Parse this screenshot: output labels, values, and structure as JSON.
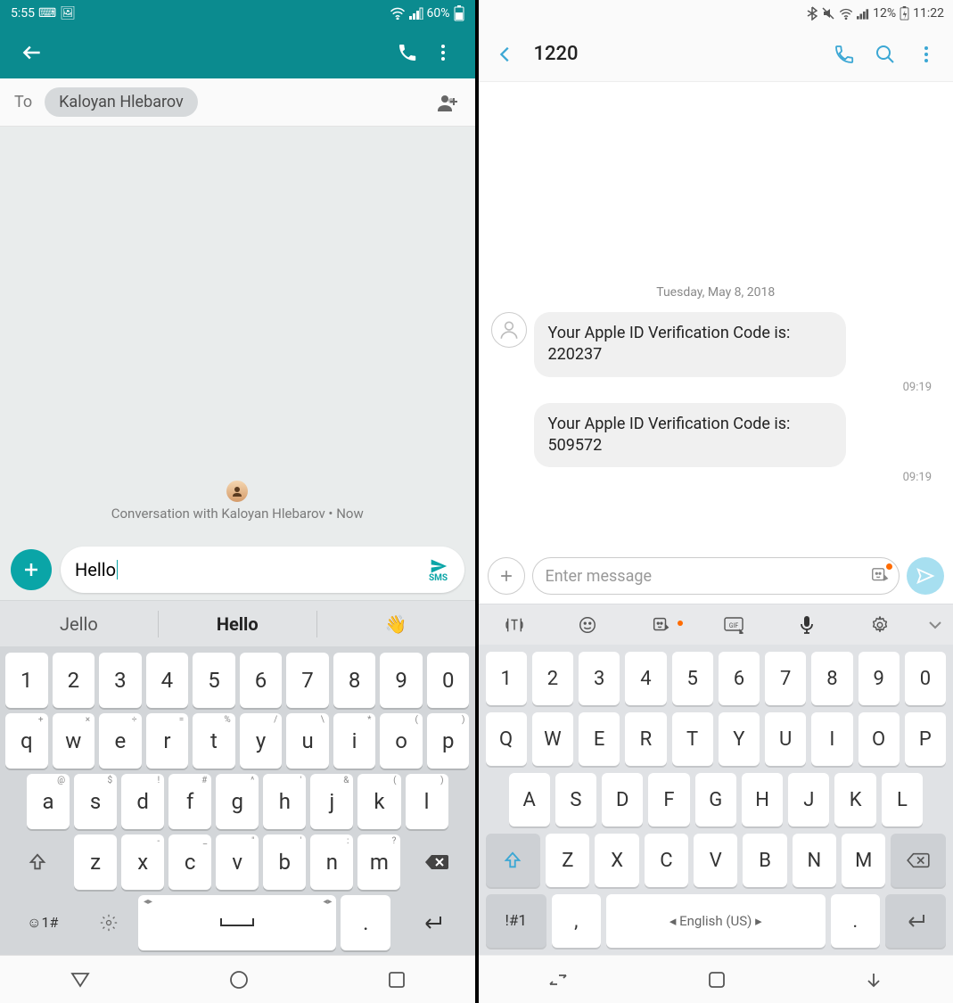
{
  "left": {
    "status": {
      "time": "5:55",
      "battery": "60%"
    },
    "toLabel": "To",
    "contactChip": "Kaloyan Hlebarov",
    "convMeta": "Conversation with Kaloyan Hlebarov • Now",
    "composeText": "Hello",
    "sendMode": "SMS",
    "suggestions": [
      "Jello",
      "Hello",
      "👋"
    ],
    "kb": {
      "row1": [
        "1",
        "2",
        "3",
        "4",
        "5",
        "6",
        "7",
        "8",
        "9",
        "0"
      ],
      "row2": [
        "q",
        "w",
        "e",
        "r",
        "t",
        "y",
        "u",
        "i",
        "o",
        "p"
      ],
      "row2alt": [
        "+",
        "×",
        "÷",
        "=",
        "%",
        "/",
        "\\",
        "*",
        "(",
        ")"
      ],
      "row3": [
        "a",
        "s",
        "d",
        "f",
        "g",
        "h",
        "j",
        "k",
        "l"
      ],
      "row3alt": [
        "@",
        "$",
        "!",
        "#",
        "^",
        "'",
        "&",
        "(",
        ")"
      ],
      "row4": [
        "z",
        "x",
        "c",
        "v",
        "b",
        "n",
        "m"
      ],
      "row4alt": [
        "",
        "-",
        "_",
        "\"",
        "'",
        ":",
        "?"
      ],
      "symKey": "☺1#",
      "periodKey": "."
    }
  },
  "right": {
    "status": {
      "battery": "12%",
      "time": "11:22"
    },
    "title": "1220",
    "dateHeader": "Tuesday, May 8, 2018",
    "messages": [
      {
        "text": "Your Apple ID Verification Code is: 220237",
        "time": "09:19"
      },
      {
        "text": "Your Apple ID Verification Code is: 509572",
        "time": "09:19"
      }
    ],
    "composePlaceholder": "Enter message",
    "kb": {
      "row1": [
        "1",
        "2",
        "3",
        "4",
        "5",
        "6",
        "7",
        "8",
        "9",
        "0"
      ],
      "row2": [
        "Q",
        "W",
        "E",
        "R",
        "T",
        "Y",
        "U",
        "I",
        "O",
        "P"
      ],
      "row3": [
        "A",
        "S",
        "D",
        "F",
        "G",
        "H",
        "J",
        "K",
        "L"
      ],
      "row4": [
        "Z",
        "X",
        "C",
        "V",
        "B",
        "N",
        "M"
      ],
      "symKey": "!#1",
      "commaKey": ",",
      "langKey": "◂  English (US)  ▸",
      "periodKey": "."
    }
  }
}
